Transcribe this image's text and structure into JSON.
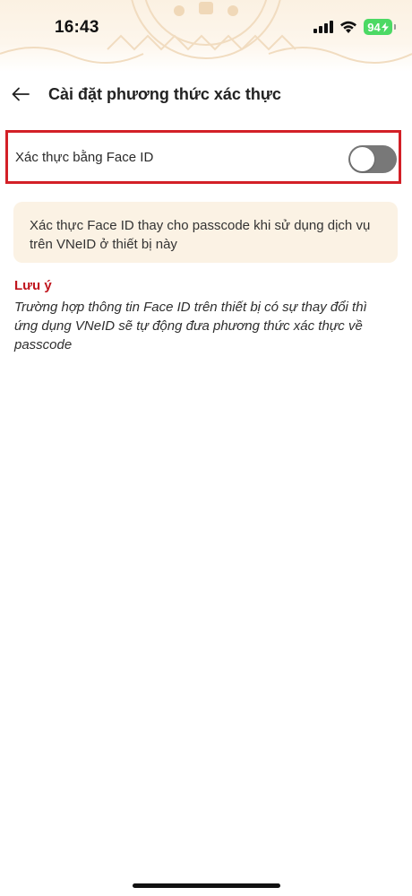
{
  "status_bar": {
    "time": "16:43",
    "battery_level": "94",
    "icons": [
      "signal-icon",
      "wifi-icon",
      "battery-icon"
    ],
    "battery_color": "#4cd964"
  },
  "header": {
    "back_icon": "arrow-left-icon",
    "title": "Cài đặt phương thức xác thực"
  },
  "face_id_setting": {
    "label": "Xác thực bằng Face ID",
    "enabled": false,
    "highlight_color": "#d32027"
  },
  "info": {
    "text": "Xác thực Face ID thay cho passcode khi sử dụng dịch vụ trên VNeID ở thiết bị này"
  },
  "note": {
    "title": "Lưu ý",
    "body": "Trường hợp thông tin Face ID trên thiết bị có sự thay đổi thì ứng dụng VNeID sẽ tự động đưa phương thức xác thực về passcode",
    "title_color": "#c0161e"
  }
}
